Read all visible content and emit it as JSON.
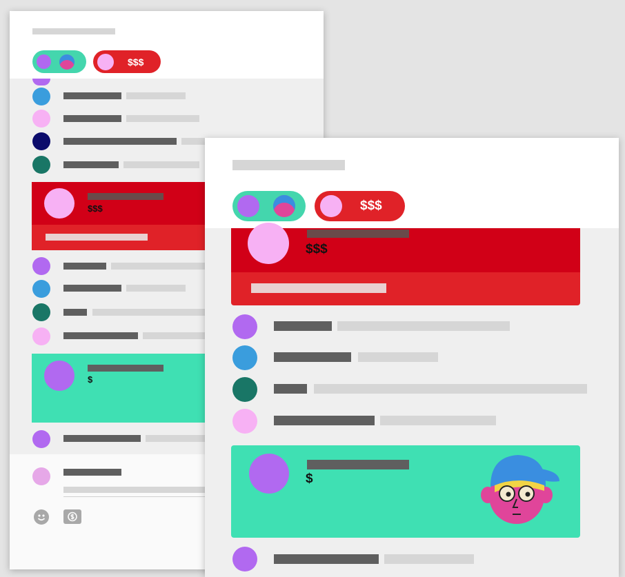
{
  "chips": {
    "price_label": "$$$"
  },
  "cards": {
    "red_amount": "$$$",
    "green_amount": "$"
  },
  "colors": {
    "super_chat_red": "#d10017",
    "super_chat_red_light": "#e02228",
    "super_chat_green": "#3fe0b3",
    "membership_chip": "#44d6ad",
    "avatar_purple": "#b169f0",
    "avatar_blue": "#3a9ddd",
    "avatar_pink": "#f7b1f4",
    "avatar_navy": "#0b0b6b",
    "avatar_teal": "#197666"
  },
  "icons": [
    "emoji-icon",
    "dollar-icon",
    "character-illustration"
  ]
}
